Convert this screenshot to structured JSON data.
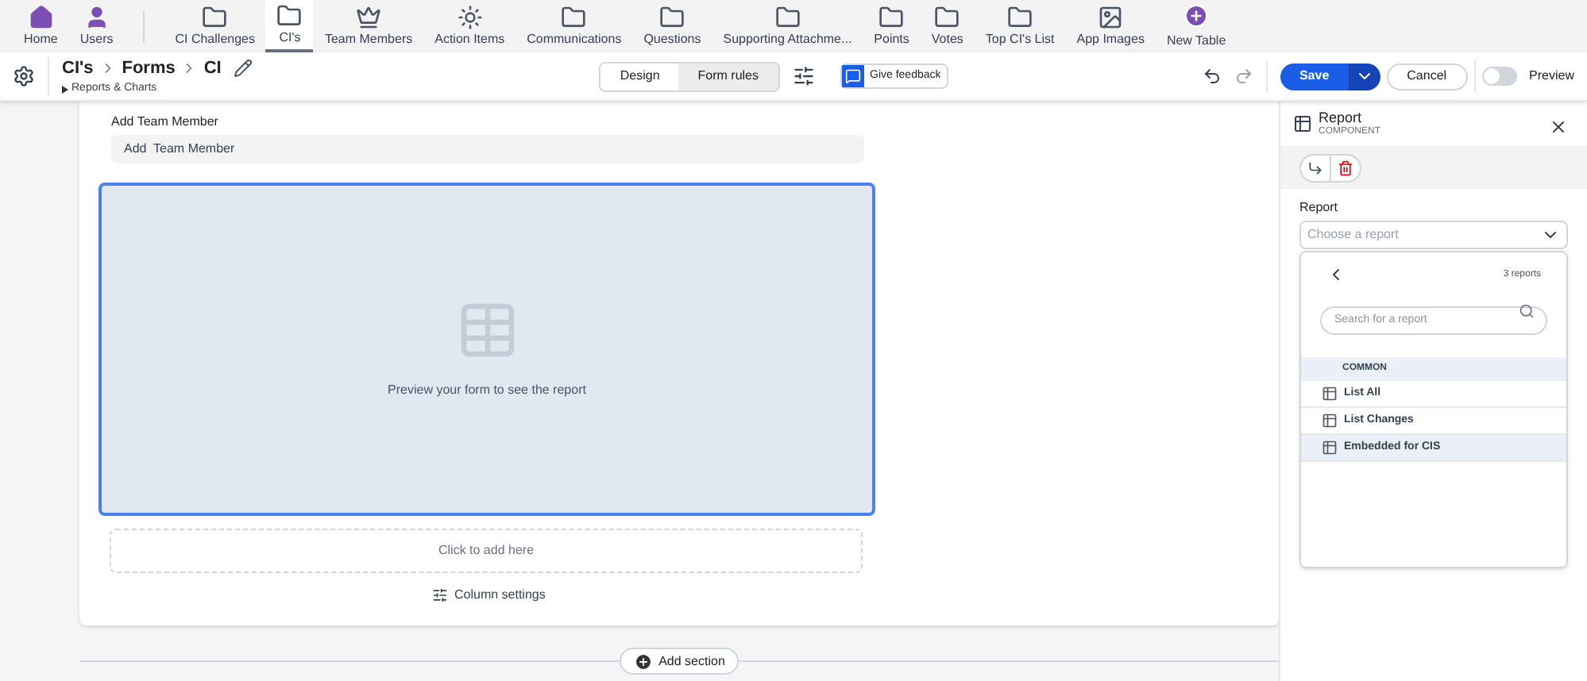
{
  "nav": [
    {
      "label": "Home",
      "kind": "home",
      "selected": false
    },
    {
      "label": "Users",
      "kind": "user",
      "selected": false
    },
    {
      "label": "CI Challenges",
      "kind": "folder",
      "selected": false
    },
    {
      "label": "CI's",
      "kind": "folder",
      "selected": true
    },
    {
      "label": "Team Members",
      "kind": "piece",
      "selected": false
    },
    {
      "label": "Action Items",
      "kind": "star",
      "selected": false
    },
    {
      "label": "Communications",
      "kind": "folder",
      "selected": false
    },
    {
      "label": "Questions",
      "kind": "folder",
      "selected": false
    },
    {
      "label": "Supporting Attachme...",
      "kind": "folder",
      "selected": false
    },
    {
      "label": "Points",
      "kind": "folder",
      "selected": false
    },
    {
      "label": "Votes",
      "kind": "folder",
      "selected": false
    },
    {
      "label": "Top CI's List",
      "kind": "folder",
      "selected": false
    },
    {
      "label": "App Images",
      "kind": "image",
      "selected": false
    },
    {
      "label": "New Table",
      "kind": "plus",
      "selected": false
    }
  ],
  "breadcrumb": [
    "CI's",
    "Forms",
    "CI"
  ],
  "sub_link": "Reports & Charts",
  "mode_tabs": [
    {
      "label": "Design",
      "selected": true
    },
    {
      "label": "Form rules",
      "selected": false
    }
  ],
  "feedback": "Give feedback",
  "save": "Save",
  "cancel": "Cancel",
  "preview": {
    "label": "Preview",
    "on": false
  },
  "form": {
    "field_label": "Add Team Member",
    "field_value": "Add  Team Member",
    "report_preview": "Preview your form to see the report",
    "add_here": "Click to add here",
    "column_settings": "Column settings",
    "add_section": "Add section"
  },
  "panel": {
    "title": "Report",
    "subtitle": "COMPONENT",
    "field_label": "Report",
    "placeholder": "Choose a report",
    "count": "3 reports",
    "search_placeholder": "Search for a report",
    "group": "COMMON",
    "reports": [
      {
        "label": "List All",
        "selected": false
      },
      {
        "label": "List Changes",
        "selected": false
      },
      {
        "label": "Embedded for CIS",
        "selected": true
      }
    ]
  }
}
